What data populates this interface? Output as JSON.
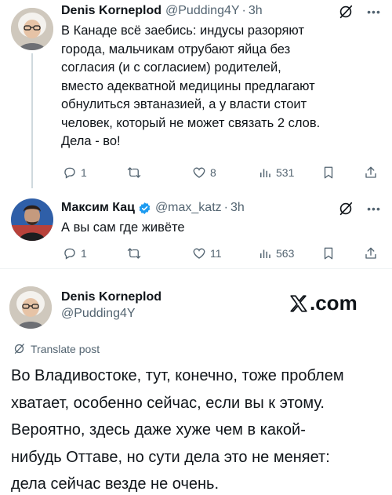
{
  "tweet1": {
    "author_name": "Denis Korneplod",
    "handle": "@Pudding4Y",
    "time": "3h",
    "text_lines": [
      "В Канаде всё заебись: индусы разоряют",
      "города, мальчикам отрубают яйца без",
      "согласия (и с согласием) родителей,",
      "вместо адекватной медицины предлагают",
      "обнулиться эвтаназией, а у власти стоит",
      "человек, который не может связать 2 слов.",
      "Дела - во!"
    ],
    "replies": "1",
    "retweets": "",
    "likes": "8",
    "views": "531",
    "icons": [
      "reply-icon",
      "retweet-icon",
      "like-icon",
      "views-icon",
      "bookmark-icon",
      "share-icon",
      "grok-icon",
      "more-icon"
    ]
  },
  "tweet2": {
    "author_name": "Максим Кац",
    "handle": "@max_katz",
    "time": "3h",
    "text_lines": [
      "А вы сам где живёте"
    ],
    "replies": "1",
    "retweets": "",
    "likes": "11",
    "views": "563",
    "verified": true
  },
  "tweet3": {
    "author_name": "Denis Korneplod",
    "handle": "@Pudding4Y",
    "brand": ".com",
    "translate_label": "Translate post",
    "text_lines": [
      "Во Владивостоке, тут, конечно, тоже проблем",
      "хватает, особенно сейчас, если вы к этому.",
      "Вероятно, здесь даже хуже чем в какой-",
      "нибудь Оттаве, но сути дела это не меняет:",
      "дела сейчас везде не очень."
    ]
  },
  "colors": {
    "text": "#0f1419",
    "secondary": "#536471",
    "verified": "#1d9bf0",
    "divider": "#eff3f4"
  }
}
